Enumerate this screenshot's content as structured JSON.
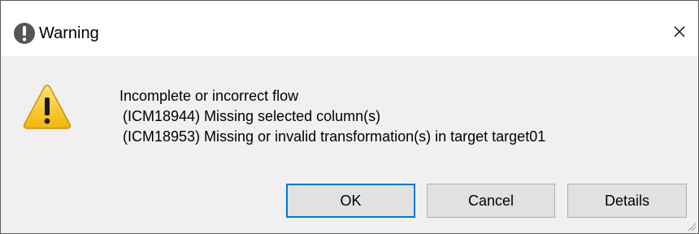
{
  "window": {
    "title": "Warning",
    "title_icon": "warning-circle-icon",
    "close_icon": "close-icon"
  },
  "message": {
    "icon": "warning-triangle-icon",
    "lines": [
      "Incomplete or incorrect flow",
      "(ICM18944) Missing selected column(s)",
      "(ICM18953) Missing or invalid transformation(s) in target target01"
    ]
  },
  "buttons": {
    "ok_label": "OK",
    "cancel_label": "Cancel",
    "details_label": "Details"
  },
  "colors": {
    "warning_yellow": "#f5c518",
    "focus_border": "#0078d7",
    "title_icon_gray": "#555555"
  }
}
